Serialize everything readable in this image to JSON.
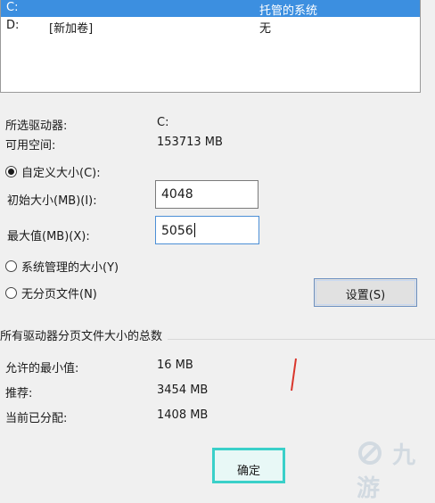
{
  "drive_list": {
    "rows": [
      {
        "drive": "C:",
        "label": "",
        "paging": "托管的系统",
        "selected": true
      },
      {
        "drive": "D:",
        "label": "[新加卷]",
        "paging": "无",
        "selected": false
      }
    ]
  },
  "selected_drive": {
    "drive_label": "所选驱动器:",
    "drive_value": "C:",
    "space_label": "可用空间:",
    "space_value": "153713 MB"
  },
  "custom_size": {
    "radio_label": "自定义大小(C):",
    "initial_label": "初始大小(MB)(I):",
    "initial_value": "4048",
    "max_label": "最大值(MB)(X):",
    "max_value": "5056"
  },
  "system_managed": {
    "radio_label": "系统管理的大小(Y)"
  },
  "no_paging": {
    "radio_label": "无分页文件(N)"
  },
  "set_button": "设置(S)",
  "totals": {
    "heading": "所有驱动器分页文件大小的总数",
    "min_label": "允许的最小值:",
    "min_value": "16 MB",
    "recommended_label": "推荐:",
    "recommended_value": "3454 MB",
    "current_label": "当前已分配:",
    "current_value": "1408 MB"
  },
  "ok_button": "确定",
  "watermark": "九游",
  "colors": {
    "selection": "#3c8fe0",
    "highlight": "#3ad0c9",
    "annotation": "#d9362c"
  }
}
